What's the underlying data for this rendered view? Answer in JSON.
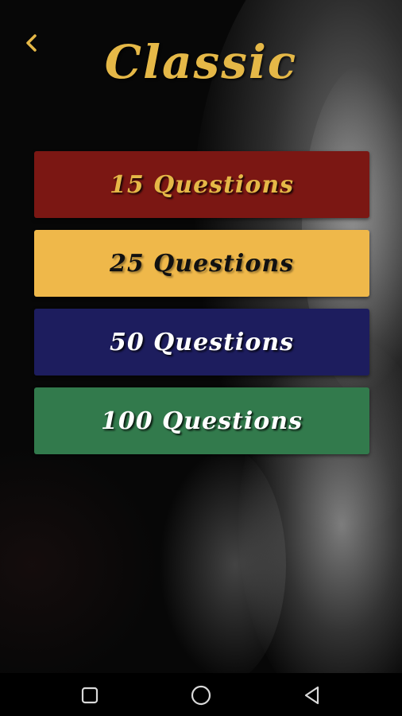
{
  "title": "Classic",
  "accent_color": "#e5b847",
  "back_icon": "chevron-left-icon",
  "options": [
    {
      "label": "15 Questions",
      "bg": "#7b1713",
      "text_color": "#e5b847"
    },
    {
      "label": "25 Questions",
      "bg": "#efb84a",
      "text_color": "#111111"
    },
    {
      "label": "50 Questions",
      "bg": "#1d1d5e",
      "text_color": "#ffffff"
    },
    {
      "label": "100 Questions",
      "bg": "#327a4c",
      "text_color": "#ffffff"
    }
  ],
  "navbar": {
    "recent_icon": "square-icon",
    "home_icon": "circle-icon",
    "back_icon": "triangle-back-icon"
  }
}
